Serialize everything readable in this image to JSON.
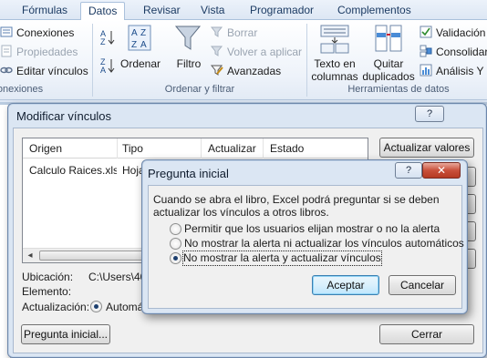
{
  "ribbon": {
    "tabs": [
      "Fórmulas",
      "Datos",
      "Revisar",
      "Vista",
      "Programador",
      "Complementos"
    ],
    "active_tab": "Datos",
    "connections": {
      "items": [
        "Conexiones",
        "Propiedades",
        "Editar vínculos"
      ],
      "group_label": "onexiones"
    },
    "sort_filter": {
      "sort_label": "Ordenar",
      "filter_label": "Filtro",
      "clear_label": "Borrar",
      "reapply_label": "Volver a aplicar",
      "advanced_label": "Avanzadas",
      "group_label": "Ordenar y filtrar"
    },
    "data_tools": {
      "text_to_columns_l1": "Texto en",
      "text_to_columns_l2": "columnas",
      "remove_dupes_l1": "Quitar",
      "remove_dupes_l2": "duplicados",
      "validation_label": "Validación",
      "consolidate_label": "Consolidar",
      "whatif_label": "Análisis Y si",
      "group_label": "Herramientas de datos"
    }
  },
  "edit_links_dialog": {
    "title": "Modificar vínculos",
    "help": "?",
    "columns": [
      "Origen",
      "Tipo",
      "Actualizar",
      "Estado"
    ],
    "rows": [
      {
        "source": "Calculo Raices.xls",
        "type": "Hoja"
      }
    ],
    "update_values_button": "Actualizar valores",
    "location_label": "Ubicación:",
    "location_value": "C:\\Users\\40",
    "item_label": "Elemento:",
    "update_label": "Actualización:",
    "update_option": "Automá",
    "startup_prompt_button": "Pregunta inicial...",
    "close_button": "Cerrar"
  },
  "startup_prompt_dialog": {
    "title": "Pregunta inicial",
    "help": "?",
    "close_glyph": "✕",
    "description": "Cuando se abra el libro, Excel podrá preguntar si se deben actualizar los vínculos a otros libros.",
    "options": [
      {
        "label": "Permitir que los usuarios elijan mostrar o no la alerta",
        "checked": false
      },
      {
        "label": "No mostrar la alerta ni actualizar los vínculos automáticos",
        "checked": false
      },
      {
        "label": "No mostrar la alerta y actualizar vínculos",
        "checked": true
      }
    ],
    "accept_button": "Aceptar",
    "cancel_button": "Cancelar"
  }
}
